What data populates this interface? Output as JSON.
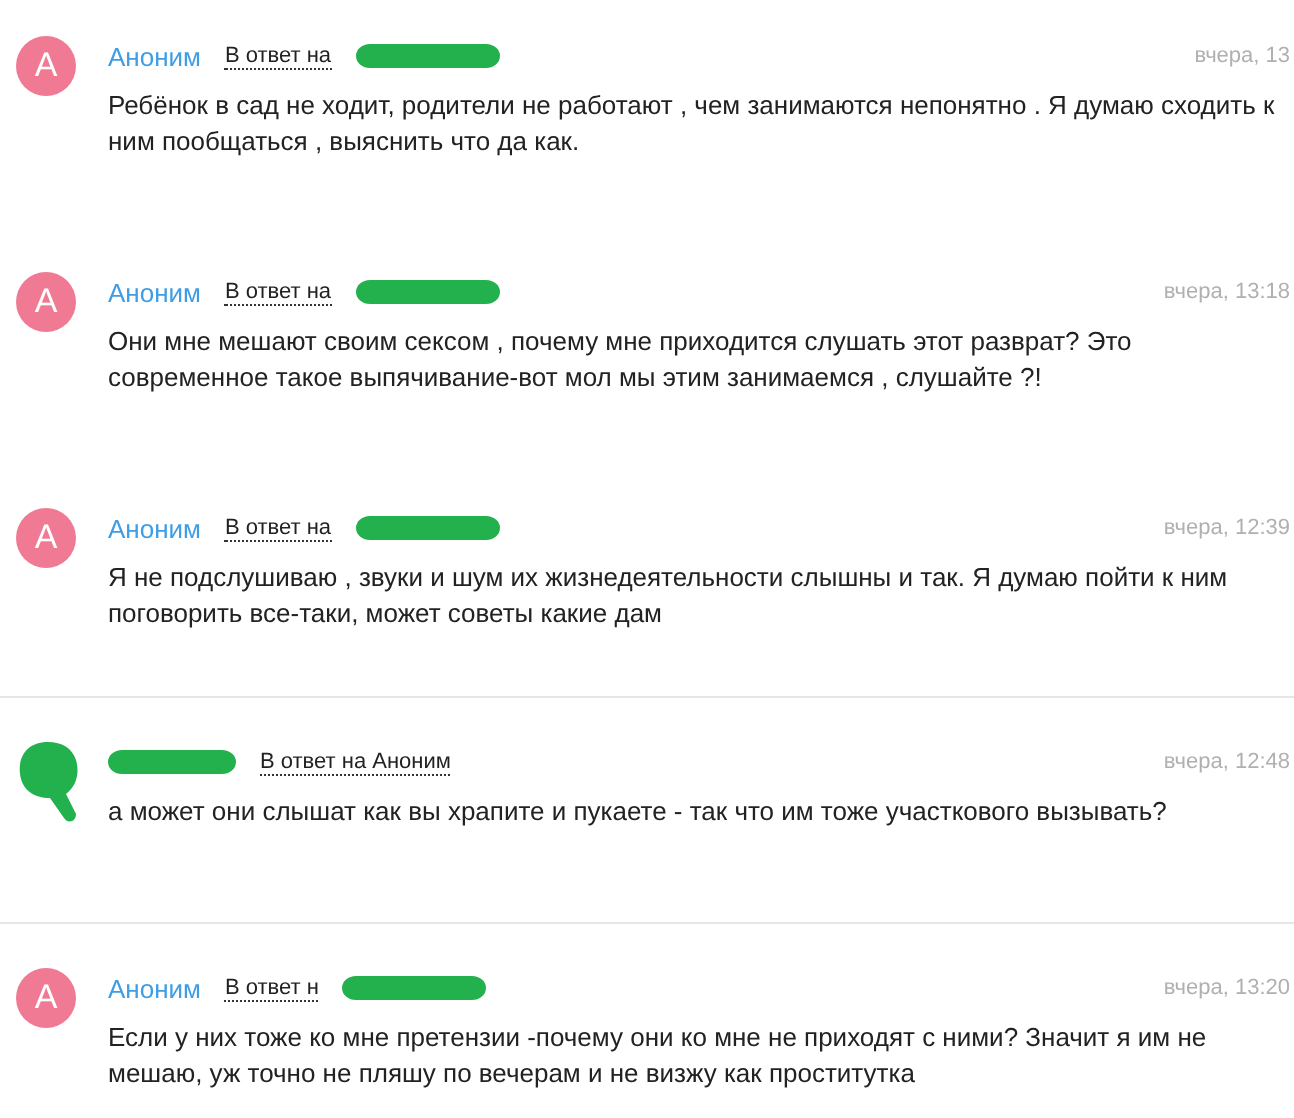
{
  "comments": [
    {
      "avatar": {
        "kind": "letter",
        "letter": "А"
      },
      "author": {
        "kind": "name",
        "text": "Аноним"
      },
      "reply": {
        "text": "В ответ на",
        "redacted": true
      },
      "time": "вчера, 13",
      "text": "Ребёнок в сад не ходит, родители не работают , чем занимаются непонятно . Я думаю сходить к ним пообщаться , выяснить что да как.",
      "separator": false
    },
    {
      "avatar": {
        "kind": "letter",
        "letter": "А"
      },
      "author": {
        "kind": "name",
        "text": "Аноним"
      },
      "reply": {
        "text": "В ответ на",
        "redacted": true
      },
      "time": "вчера, 13:18",
      "text": "Они мне мешают своим сексом , почему мне приходится слушать этот разврат? Это современное такое выпячивание-вот мол мы этим занимаемся , слушайте ?!",
      "separator": false
    },
    {
      "avatar": {
        "kind": "letter",
        "letter": "А"
      },
      "author": {
        "kind": "name",
        "text": "Аноним"
      },
      "reply": {
        "text": "В ответ на",
        "redacted": true
      },
      "time": "вчера, 12:39",
      "text": "Я не подслушиваю , звуки и шум их жизнедеятельности слышны и так. Я думаю пойти к ним поговорить все-таки, может советы какие дам",
      "separator": true
    },
    {
      "avatar": {
        "kind": "redacted"
      },
      "author": {
        "kind": "redacted"
      },
      "reply": {
        "text": "В ответ на Аноним",
        "redacted": false
      },
      "time": "вчера, 12:48",
      "text": "а может они слышат как вы храпите и пукаете - так что им тоже участкового вызывать?",
      "separator": true
    },
    {
      "avatar": {
        "kind": "letter",
        "letter": "А"
      },
      "author": {
        "kind": "name",
        "text": "Аноним"
      },
      "reply": {
        "text": "В ответ н",
        "redacted": true
      },
      "time": "вчера, 13:20",
      "text": "Если у них тоже ко мне претензии -почему они ко мне не приходят с ними? Значит я им не мешаю, уж точно не пляшу по вечерам и не визжу как проститутка",
      "separator": false
    }
  ]
}
